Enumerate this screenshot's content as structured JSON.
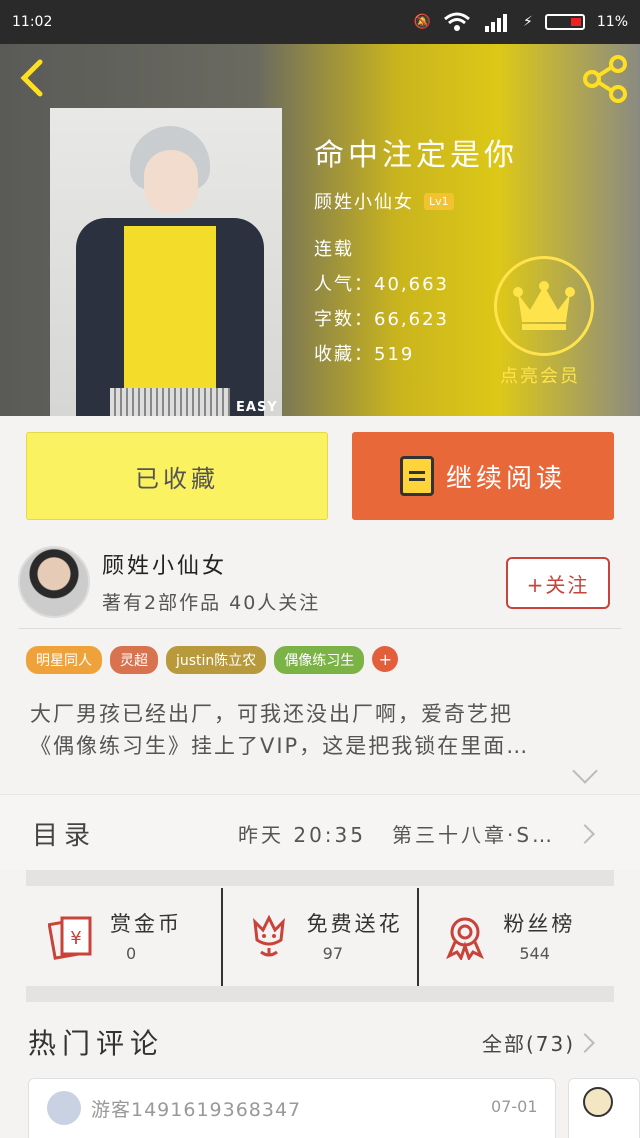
{
  "status_bar": {
    "time": "11:02",
    "battery": "11%"
  },
  "header": {
    "book_title": "命中注定是你",
    "author": "顾姓小仙女",
    "level": "Lv1",
    "status": "连载",
    "popularity_label": "人气：40,663",
    "word_count_label": "字数：66,623",
    "collect_label": "收藏：519",
    "vip_label": "点亮会员",
    "cover_text": "EASY"
  },
  "buttons": {
    "collected": "已收藏",
    "continue_reading": "继续阅读"
  },
  "author_section": {
    "name": "顾姓小仙女",
    "stats": "著有2部作品  40人关注",
    "follow": "+关注"
  },
  "tags": [
    {
      "label": "明星同人",
      "color": "#f0a23a"
    },
    {
      "label": "灵超",
      "color": "#d9734f"
    },
    {
      "label": "justin陈立农",
      "color": "#b89a3c"
    },
    {
      "label": "偶像练习生",
      "color": "#7cb346"
    }
  ],
  "tag_more": "+",
  "description": {
    "line1": "大厂男孩已经出厂，可我还没出厂啊，爱奇艺把",
    "line2": "《偶像练习生》挂上了VIP，这是把我锁在里面…"
  },
  "catalog": {
    "label": "目录",
    "time": "昨天 20:35",
    "chapter": "第三十八章·S…"
  },
  "actions": [
    {
      "label": "赏金币",
      "value": "0",
      "icon": "red-envelope-icon"
    },
    {
      "label": "免费送花",
      "value": "97",
      "icon": "flower-icon"
    },
    {
      "label": "粉丝榜",
      "value": "544",
      "icon": "medal-icon"
    }
  ],
  "comments": {
    "title": "热门评论",
    "all": "全部(73)",
    "first": {
      "user": "游客1491619368347",
      "date": "07-01"
    }
  },
  "colors": {
    "accent_orange": "#e9683a",
    "accent_yellow": "#fbf262",
    "vip_gold": "#ffe34d",
    "follow_red": "#c8433a"
  }
}
